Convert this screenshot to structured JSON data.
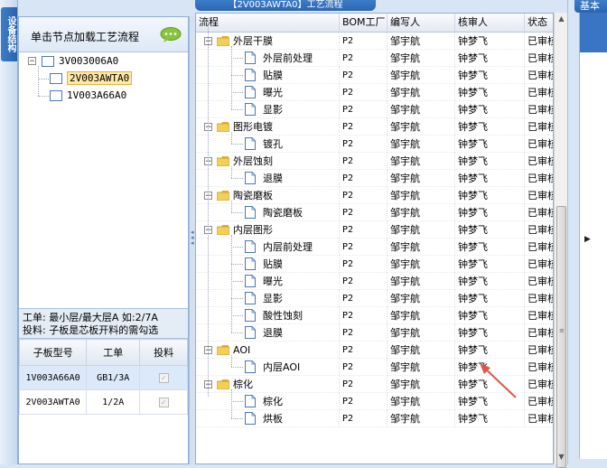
{
  "left_tab_label": "设备结构",
  "left_panel": {
    "title": "单击节点加载工艺流程",
    "tree": [
      {
        "label": "3V003006A0",
        "level": 0,
        "expanded": true
      },
      {
        "label": "2V003AWTA0",
        "level": 1,
        "selected": true
      },
      {
        "label": "1V003A66A0",
        "level": 1
      }
    ],
    "info_line1": "工单: 最小层/最大层A 如:2/7A",
    "info_line2": "投料: 子板是芯板开料的需勾选",
    "board_table": {
      "headers": [
        "子板型号",
        "工单",
        "投料"
      ],
      "rows": [
        {
          "model": "1V003A66A0",
          "order": "GB1/3A",
          "checked": true
        },
        {
          "model": "2V003AWTA0",
          "order": "1/2A",
          "checked": true
        }
      ]
    }
  },
  "top_tab_label": "【2V003AWTA0】工艺流程",
  "right_tab_label": "基本",
  "grid": {
    "headers": [
      "流程",
      "BOM工厂",
      "编写人",
      "核审人",
      "状态"
    ],
    "rows": [
      {
        "level": 0,
        "label": "外层干膜",
        "factory": "P2",
        "writer": "邹宇航",
        "reviewer": "钟梦飞",
        "status": "已审核"
      },
      {
        "level": 1,
        "label": "外层前处理",
        "factory": "P2",
        "writer": "邹宇航",
        "reviewer": "钟梦飞",
        "status": "已审核"
      },
      {
        "level": 1,
        "label": "贴膜",
        "factory": "P2",
        "writer": "邹宇航",
        "reviewer": "钟梦飞",
        "status": "已审核"
      },
      {
        "level": 1,
        "label": "曝光",
        "factory": "P2",
        "writer": "邹宇航",
        "reviewer": "钟梦飞",
        "status": "已审核"
      },
      {
        "level": 1,
        "label": "显影",
        "factory": "P2",
        "writer": "邹宇航",
        "reviewer": "钟梦飞",
        "status": "已审核"
      },
      {
        "level": 0,
        "label": "图形电镀",
        "factory": "P2",
        "writer": "邹宇航",
        "reviewer": "钟梦飞",
        "status": "已审核"
      },
      {
        "level": 1,
        "label": "镀孔",
        "factory": "P2",
        "writer": "邹宇航",
        "reviewer": "钟梦飞",
        "status": "已审核"
      },
      {
        "level": 0,
        "label": "外层蚀刻",
        "factory": "P2",
        "writer": "邹宇航",
        "reviewer": "钟梦飞",
        "status": "已审核"
      },
      {
        "level": 1,
        "label": "退膜",
        "factory": "P2",
        "writer": "邹宇航",
        "reviewer": "钟梦飞",
        "status": "已审核"
      },
      {
        "level": 0,
        "label": "陶瓷磨板",
        "factory": "P2",
        "writer": "邹宇航",
        "reviewer": "钟梦飞",
        "status": "已审核"
      },
      {
        "level": 1,
        "label": "陶瓷磨板",
        "factory": "P2",
        "writer": "邹宇航",
        "reviewer": "钟梦飞",
        "status": "已审核"
      },
      {
        "level": 0,
        "label": "内层图形",
        "factory": "P2",
        "writer": "邹宇航",
        "reviewer": "钟梦飞",
        "status": "已审核"
      },
      {
        "level": 1,
        "label": "内层前处理",
        "factory": "P2",
        "writer": "邹宇航",
        "reviewer": "钟梦飞",
        "status": "已审核"
      },
      {
        "level": 1,
        "label": "贴膜",
        "factory": "P2",
        "writer": "邹宇航",
        "reviewer": "钟梦飞",
        "status": "已审核"
      },
      {
        "level": 1,
        "label": "曝光",
        "factory": "P2",
        "writer": "邹宇航",
        "reviewer": "钟梦飞",
        "status": "已审核"
      },
      {
        "level": 1,
        "label": "显影",
        "factory": "P2",
        "writer": "邹宇航",
        "reviewer": "钟梦飞",
        "status": "已审核"
      },
      {
        "level": 1,
        "label": "酸性蚀刻",
        "factory": "P2",
        "writer": "邹宇航",
        "reviewer": "钟梦飞",
        "status": "已审核"
      },
      {
        "level": 1,
        "label": "退膜",
        "factory": "P2",
        "writer": "邹宇航",
        "reviewer": "钟梦飞",
        "status": "已审核"
      },
      {
        "level": 0,
        "label": "AOI",
        "factory": "P2",
        "writer": "邹宇航",
        "reviewer": "钟梦飞",
        "status": "已审核"
      },
      {
        "level": 1,
        "label": "内层AOI",
        "factory": "P2",
        "writer": "邹宇航",
        "reviewer": "钟梦飞",
        "status": "已审核"
      },
      {
        "level": 0,
        "label": "棕化",
        "factory": "P2",
        "writer": "邹宇航",
        "reviewer": "钟梦飞",
        "status": "已审核"
      },
      {
        "level": 1,
        "label": "棕化",
        "factory": "P2",
        "writer": "邹宇航",
        "reviewer": "钟梦飞",
        "status": "已审核"
      },
      {
        "level": 1,
        "label": "烘板",
        "factory": "P2",
        "writer": "邹宇航",
        "reviewer": "钟梦飞",
        "status": "已审核"
      }
    ]
  },
  "colors": {
    "accent": "#2a66b2",
    "selected_node": "#ffe9a6",
    "annotation": "#e2554a"
  },
  "icons": {
    "speech": "speech-bubble-icon",
    "folder": "folder-icon",
    "doc": "document-icon"
  }
}
